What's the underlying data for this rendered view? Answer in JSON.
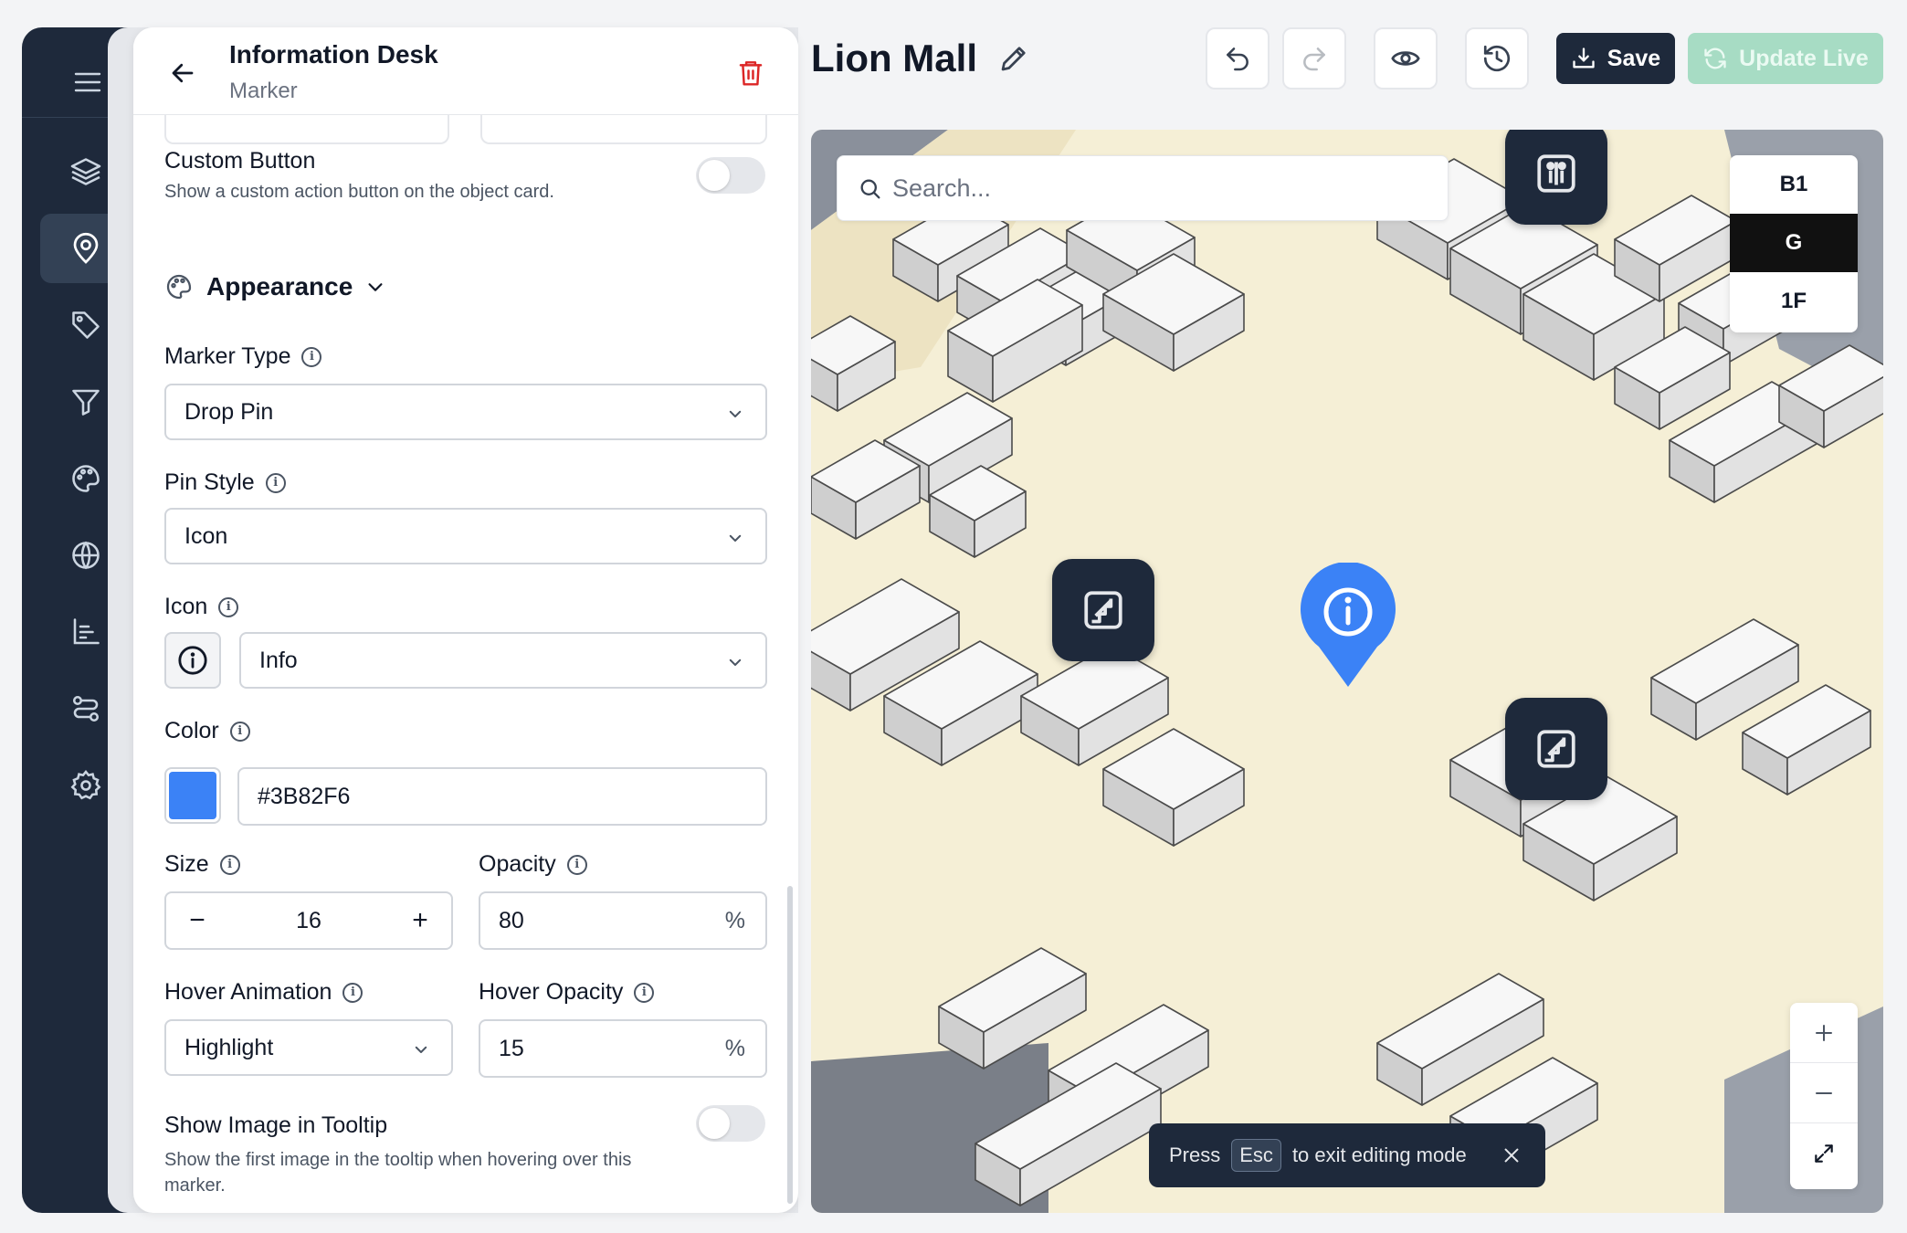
{
  "panel": {
    "title": "Information Desk",
    "subtitle": "Marker"
  },
  "custom_button": {
    "label": "Custom Button",
    "description": "Show a custom action button on the object card.",
    "enabled": false
  },
  "appearance": {
    "section_title": "Appearance",
    "marker_type": {
      "label": "Marker Type",
      "value": "Drop Pin"
    },
    "pin_style": {
      "label": "Pin Style",
      "value": "Icon"
    },
    "icon": {
      "label": "Icon",
      "value": "Info",
      "icon_name": "info-icon"
    },
    "color": {
      "label": "Color",
      "value": "#3B82F6"
    },
    "size": {
      "label": "Size",
      "value": "16",
      "minus": "−",
      "plus": "+"
    },
    "opacity": {
      "label": "Opacity",
      "value": "80",
      "unit": "%"
    },
    "hover_animation": {
      "label": "Hover Animation",
      "value": "Highlight"
    },
    "hover_opacity": {
      "label": "Hover Opacity",
      "value": "15",
      "unit": "%"
    },
    "show_image": {
      "label": "Show Image in Tooltip",
      "description": "Show the first image in the tooltip when hovering over this marker.",
      "enabled": false
    }
  },
  "toolbar": {
    "doc_title": "Lion Mall",
    "save_label": "Save",
    "update_label": "Update Live"
  },
  "map": {
    "search_placeholder": "Search...",
    "floors": [
      "B1",
      "G",
      "1F"
    ],
    "active_floor": "G",
    "toast": {
      "prefix": "Press",
      "key": "Esc",
      "suffix": "to exit editing mode"
    },
    "pin_color": "#3B82F6"
  },
  "colors": {
    "sidebar": "#1e293b",
    "accent": "#3B82F6",
    "danger": "#dc2626",
    "update_live": "#a7dcc4"
  }
}
